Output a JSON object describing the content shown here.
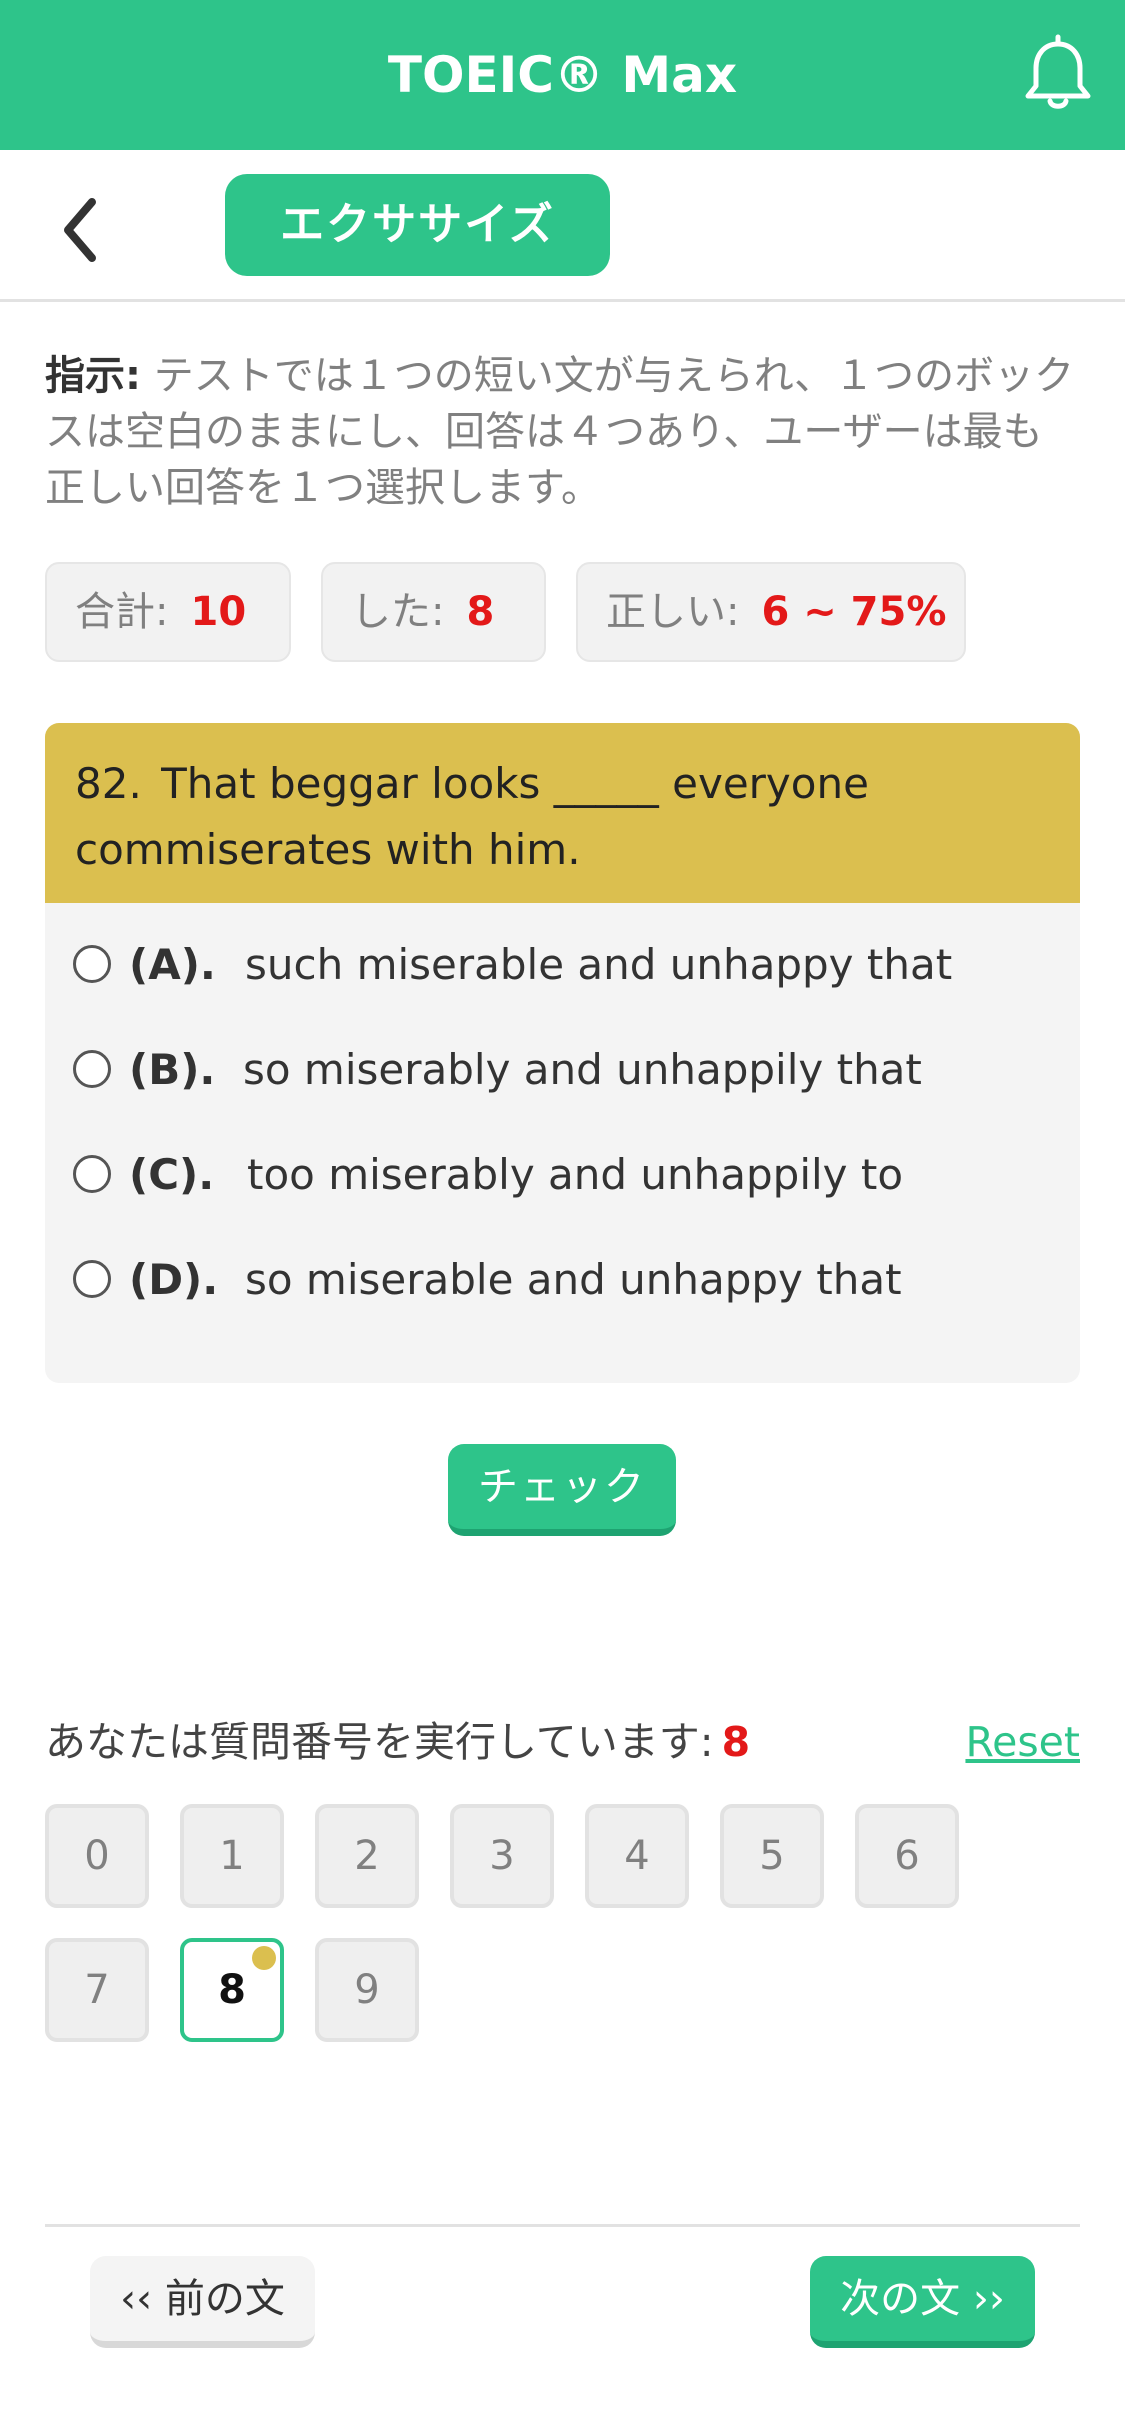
{
  "header": {
    "title": "TOEIC® Max",
    "bell_icon": "bell-icon",
    "color": "#2ec48a"
  },
  "subheader": {
    "back_icon": "chevron-left-icon",
    "exercise_label": "エクササイズ"
  },
  "instructions": {
    "label": "指示:",
    "text": " テストでは１つの短い文が与えられ、１つのボックスは空白のままにし、回答は４つあり、ユーザーは最も正しい回答を１つ選択します。"
  },
  "stats": {
    "total_label": "合計:",
    "total_value": "10",
    "done_label": "した:",
    "done_value": "8",
    "correct_label": "正しい:",
    "correct_value": "6 ~ 75%"
  },
  "question": {
    "number": "82.",
    "text": "That beggar looks _____ everyone commiserates with him.",
    "options": [
      {
        "letter": "(A).",
        "text": "such miserable and unhappy that"
      },
      {
        "letter": "(B).",
        "text": "so miserably and unhappily that"
      },
      {
        "letter": "(C).",
        "text": "too miserably and unhappily to"
      },
      {
        "letter": "(D).",
        "text": "so miserable and unhappy that"
      }
    ],
    "header_color": "#dbbf4f"
  },
  "check_label": "チェック",
  "progress": {
    "label": "あなたは質問番号を実行しています:",
    "current": "8",
    "reset_label": "Reset",
    "numbers": [
      "0",
      "1",
      "2",
      "3",
      "4",
      "5",
      "6",
      "7",
      "8",
      "9"
    ]
  },
  "nav": {
    "prev_label": "‹‹ 前の文",
    "next_label": "次の文 ››"
  }
}
